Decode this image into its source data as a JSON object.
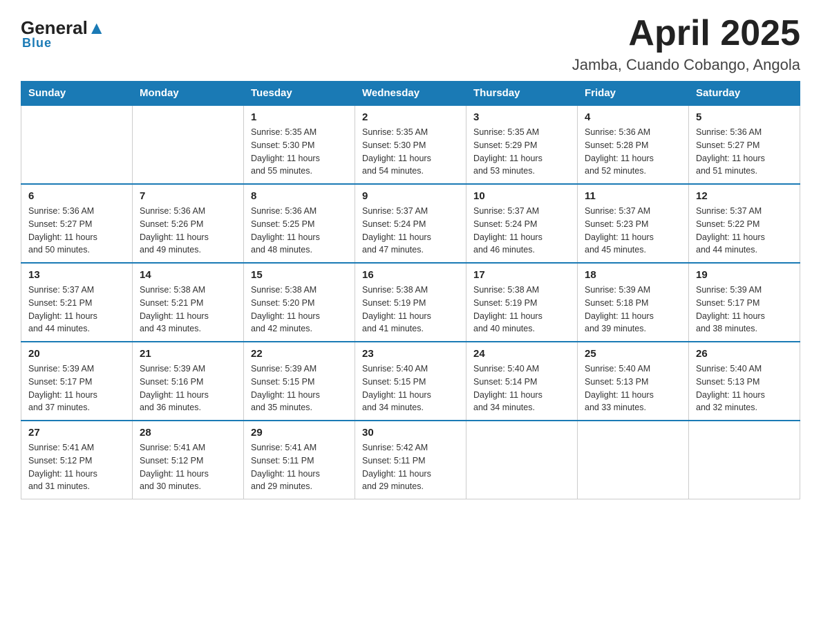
{
  "header": {
    "logo_general": "General",
    "logo_blue": "Blue",
    "title": "April 2025",
    "subtitle": "Jamba, Cuando Cobango, Angola"
  },
  "calendar": {
    "days_of_week": [
      "Sunday",
      "Monday",
      "Tuesday",
      "Wednesday",
      "Thursday",
      "Friday",
      "Saturday"
    ],
    "weeks": [
      [
        {
          "day": "",
          "info": ""
        },
        {
          "day": "",
          "info": ""
        },
        {
          "day": "1",
          "info": "Sunrise: 5:35 AM\nSunset: 5:30 PM\nDaylight: 11 hours\nand 55 minutes."
        },
        {
          "day": "2",
          "info": "Sunrise: 5:35 AM\nSunset: 5:30 PM\nDaylight: 11 hours\nand 54 minutes."
        },
        {
          "day": "3",
          "info": "Sunrise: 5:35 AM\nSunset: 5:29 PM\nDaylight: 11 hours\nand 53 minutes."
        },
        {
          "day": "4",
          "info": "Sunrise: 5:36 AM\nSunset: 5:28 PM\nDaylight: 11 hours\nand 52 minutes."
        },
        {
          "day": "5",
          "info": "Sunrise: 5:36 AM\nSunset: 5:27 PM\nDaylight: 11 hours\nand 51 minutes."
        }
      ],
      [
        {
          "day": "6",
          "info": "Sunrise: 5:36 AM\nSunset: 5:27 PM\nDaylight: 11 hours\nand 50 minutes."
        },
        {
          "day": "7",
          "info": "Sunrise: 5:36 AM\nSunset: 5:26 PM\nDaylight: 11 hours\nand 49 minutes."
        },
        {
          "day": "8",
          "info": "Sunrise: 5:36 AM\nSunset: 5:25 PM\nDaylight: 11 hours\nand 48 minutes."
        },
        {
          "day": "9",
          "info": "Sunrise: 5:37 AM\nSunset: 5:24 PM\nDaylight: 11 hours\nand 47 minutes."
        },
        {
          "day": "10",
          "info": "Sunrise: 5:37 AM\nSunset: 5:24 PM\nDaylight: 11 hours\nand 46 minutes."
        },
        {
          "day": "11",
          "info": "Sunrise: 5:37 AM\nSunset: 5:23 PM\nDaylight: 11 hours\nand 45 minutes."
        },
        {
          "day": "12",
          "info": "Sunrise: 5:37 AM\nSunset: 5:22 PM\nDaylight: 11 hours\nand 44 minutes."
        }
      ],
      [
        {
          "day": "13",
          "info": "Sunrise: 5:37 AM\nSunset: 5:21 PM\nDaylight: 11 hours\nand 44 minutes."
        },
        {
          "day": "14",
          "info": "Sunrise: 5:38 AM\nSunset: 5:21 PM\nDaylight: 11 hours\nand 43 minutes."
        },
        {
          "day": "15",
          "info": "Sunrise: 5:38 AM\nSunset: 5:20 PM\nDaylight: 11 hours\nand 42 minutes."
        },
        {
          "day": "16",
          "info": "Sunrise: 5:38 AM\nSunset: 5:19 PM\nDaylight: 11 hours\nand 41 minutes."
        },
        {
          "day": "17",
          "info": "Sunrise: 5:38 AM\nSunset: 5:19 PM\nDaylight: 11 hours\nand 40 minutes."
        },
        {
          "day": "18",
          "info": "Sunrise: 5:39 AM\nSunset: 5:18 PM\nDaylight: 11 hours\nand 39 minutes."
        },
        {
          "day": "19",
          "info": "Sunrise: 5:39 AM\nSunset: 5:17 PM\nDaylight: 11 hours\nand 38 minutes."
        }
      ],
      [
        {
          "day": "20",
          "info": "Sunrise: 5:39 AM\nSunset: 5:17 PM\nDaylight: 11 hours\nand 37 minutes."
        },
        {
          "day": "21",
          "info": "Sunrise: 5:39 AM\nSunset: 5:16 PM\nDaylight: 11 hours\nand 36 minutes."
        },
        {
          "day": "22",
          "info": "Sunrise: 5:39 AM\nSunset: 5:15 PM\nDaylight: 11 hours\nand 35 minutes."
        },
        {
          "day": "23",
          "info": "Sunrise: 5:40 AM\nSunset: 5:15 PM\nDaylight: 11 hours\nand 34 minutes."
        },
        {
          "day": "24",
          "info": "Sunrise: 5:40 AM\nSunset: 5:14 PM\nDaylight: 11 hours\nand 34 minutes."
        },
        {
          "day": "25",
          "info": "Sunrise: 5:40 AM\nSunset: 5:13 PM\nDaylight: 11 hours\nand 33 minutes."
        },
        {
          "day": "26",
          "info": "Sunrise: 5:40 AM\nSunset: 5:13 PM\nDaylight: 11 hours\nand 32 minutes."
        }
      ],
      [
        {
          "day": "27",
          "info": "Sunrise: 5:41 AM\nSunset: 5:12 PM\nDaylight: 11 hours\nand 31 minutes."
        },
        {
          "day": "28",
          "info": "Sunrise: 5:41 AM\nSunset: 5:12 PM\nDaylight: 11 hours\nand 30 minutes."
        },
        {
          "day": "29",
          "info": "Sunrise: 5:41 AM\nSunset: 5:11 PM\nDaylight: 11 hours\nand 29 minutes."
        },
        {
          "day": "30",
          "info": "Sunrise: 5:42 AM\nSunset: 5:11 PM\nDaylight: 11 hours\nand 29 minutes."
        },
        {
          "day": "",
          "info": ""
        },
        {
          "day": "",
          "info": ""
        },
        {
          "day": "",
          "info": ""
        }
      ]
    ]
  }
}
